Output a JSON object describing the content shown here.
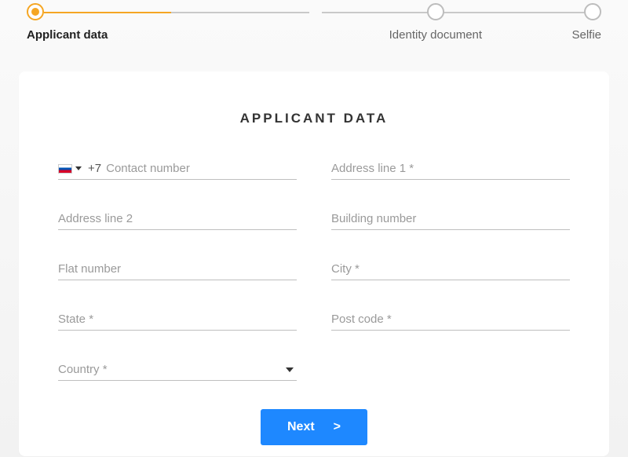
{
  "stepper": {
    "steps": [
      {
        "label": "Applicant data",
        "active": true
      },
      {
        "label": "Identity document",
        "active": false
      },
      {
        "label": "Selfie",
        "active": false
      }
    ]
  },
  "form": {
    "title": "APPLICANT DATA",
    "phone": {
      "dial_code": "+7",
      "placeholder": "Contact number",
      "value": ""
    },
    "address1": {
      "placeholder": "Address line 1 *",
      "value": ""
    },
    "address2": {
      "placeholder": "Address line 2",
      "value": ""
    },
    "building": {
      "placeholder": "Building number",
      "value": ""
    },
    "flat": {
      "placeholder": "Flat number",
      "value": ""
    },
    "city": {
      "placeholder": "City *",
      "value": ""
    },
    "state": {
      "placeholder": "State *",
      "value": ""
    },
    "postcode": {
      "placeholder": "Post code *",
      "value": ""
    },
    "country": {
      "placeholder": "Country *",
      "value": ""
    }
  },
  "actions": {
    "next": "Next",
    "next_arrow": ">"
  },
  "colors": {
    "accent": "#f5a623",
    "primary": "#1e88ff"
  }
}
